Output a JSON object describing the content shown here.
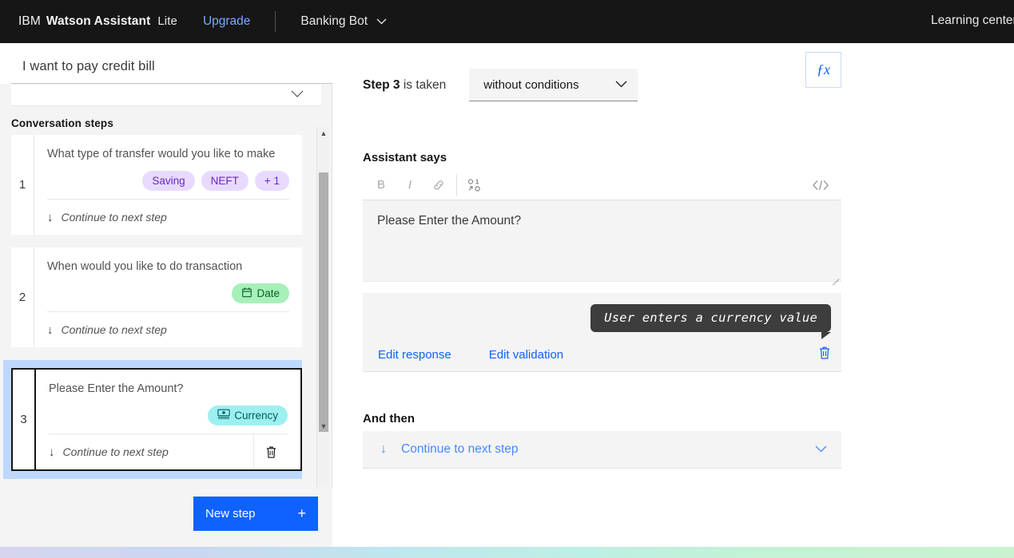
{
  "header": {
    "brand_ibm": "IBM",
    "brand_product": "Watson Assistant",
    "plan": "Lite",
    "upgrade": "Upgrade",
    "assistant_name": "Banking Bot",
    "learning_center": "Learning center",
    "chevron_icon": "chevron-down-icon"
  },
  "left_panel": {
    "page_title": "I want to pay credit bill",
    "steps_heading": "Conversation steps",
    "continue_label": "Continue to next step",
    "new_step_label": "New step",
    "new_step_plus": "+",
    "steps": [
      {
        "number": "1",
        "prompt": "What type of transfer would you like to make",
        "tags": [
          {
            "label": "Saving",
            "color": "purple",
            "icon": ""
          },
          {
            "label": "NEFT",
            "color": "purple",
            "icon": ""
          },
          {
            "label": "+ 1",
            "color": "purple",
            "icon": ""
          }
        ],
        "selected": false,
        "has_trash": false
      },
      {
        "number": "2",
        "prompt": "When would you like to do transaction",
        "tags": [
          {
            "label": "Date",
            "color": "green",
            "icon": "calendar-icon"
          }
        ],
        "selected": false,
        "has_trash": false
      },
      {
        "number": "3",
        "prompt": "Please Enter the Amount?",
        "tags": [
          {
            "label": "Currency",
            "color": "teal",
            "icon": "banknote-icon"
          }
        ],
        "selected": true,
        "has_trash": true
      }
    ]
  },
  "right_panel": {
    "condition_prefix_bold": "Step 3",
    "condition_prefix_rest": " is taken",
    "condition_value": "without conditions",
    "fx_label": "ƒx",
    "assistant_says_label": "Assistant says",
    "toolbar": {
      "bold": "B",
      "italic": "I",
      "link_icon": "link-icon",
      "variable_icon": "variable-icon",
      "code_icon": "code-icon"
    },
    "response_text": "Please Enter the Amount?",
    "preview_bubble": "User enters a currency value",
    "edit_response": "Edit response",
    "edit_validation": "Edit validation",
    "and_then_label": "And then",
    "and_then_value": "Continue to next step"
  },
  "colors": {
    "accent_blue": "#0f62fe",
    "header_dark": "#161616",
    "tag_purple_bg": "#e8daff",
    "tag_purple_fg": "#6929c4",
    "tag_green_bg": "#a7f0ba",
    "tag_green_fg": "#0e6027",
    "tag_teal_bg": "#9ef0f0",
    "tag_teal_fg": "#005d5d",
    "selected_bg": "#bed8fd",
    "bubble_bg": "#3d3d3d"
  }
}
